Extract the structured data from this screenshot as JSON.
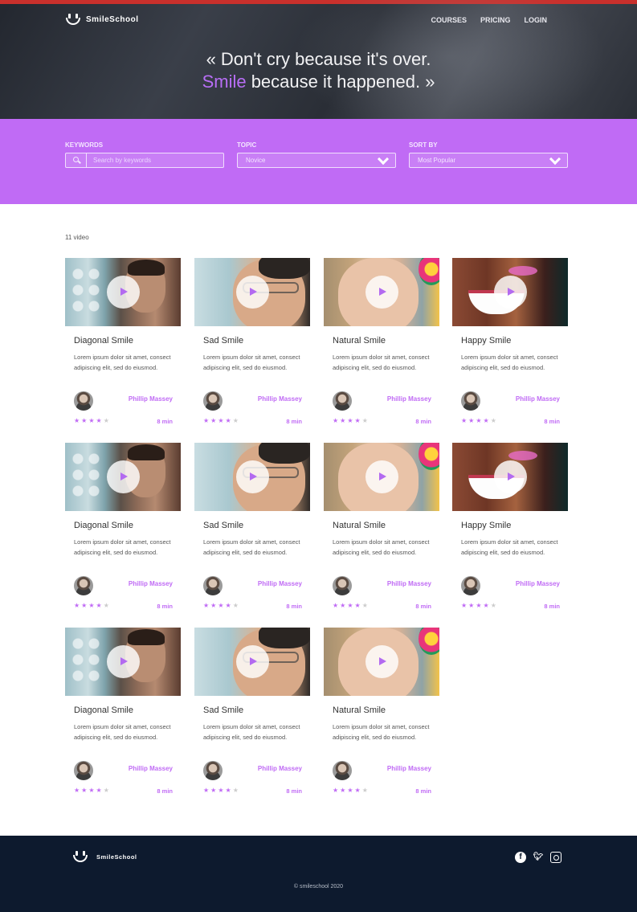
{
  "app": {
    "brand": "SmileSchool"
  },
  "nav": {
    "items": [
      "COURSES",
      "PRICING",
      "LOGIN"
    ]
  },
  "hero": {
    "quote_line1": "« Don't cry because it's over.",
    "quote_accent": "Smile",
    "quote_line2_rest": " because it happened. »"
  },
  "filters": {
    "keywords": {
      "label": "KEYWORDS",
      "placeholder": "Search by keywords"
    },
    "topic": {
      "label": "TOPIC",
      "value": "Novice"
    },
    "sort": {
      "label": "SORT BY",
      "value": "Most Popular"
    }
  },
  "results": {
    "count_label": "11 video"
  },
  "colors": {
    "accent": "#c06bf5",
    "hero_bg": "#2b2f37",
    "footer_bg": "#0d1a2e"
  },
  "cards": [
    {
      "title": "Diagonal Smile",
      "desc": "Lorem ipsum dolor sit amet, consect adipiscing elit, sed do eiusmod.",
      "author": "Phillip Massey",
      "duration": "8 min",
      "rating": 4,
      "thumb": "diagonal"
    },
    {
      "title": "Sad Smile",
      "desc": "Lorem ipsum dolor sit amet, consect adipiscing elit, sed do eiusmod.",
      "author": "Phillip Massey",
      "duration": "8 min",
      "rating": 4,
      "thumb": "sad"
    },
    {
      "title": "Natural Smile",
      "desc": "Lorem ipsum dolor sit amet, consect adipiscing elit, sed do eiusmod.",
      "author": "Phillip Massey",
      "duration": "8 min",
      "rating": 4,
      "thumb": "natural"
    },
    {
      "title": "Happy Smile",
      "desc": "Lorem ipsum dolor sit amet, consect adipiscing elit, sed do eiusmod.",
      "author": "Phillip Massey",
      "duration": "8 min",
      "rating": 4,
      "thumb": "happy"
    },
    {
      "title": "Diagonal Smile",
      "desc": "Lorem ipsum dolor sit amet, consect adipiscing elit, sed do eiusmod.",
      "author": "Phillip Massey",
      "duration": "8 min",
      "rating": 4,
      "thumb": "diagonal"
    },
    {
      "title": "Sad Smile",
      "desc": "Lorem ipsum dolor sit amet, consect adipiscing elit, sed do eiusmod.",
      "author": "Phillip Massey",
      "duration": "8 min",
      "rating": 4,
      "thumb": "sad"
    },
    {
      "title": "Natural Smile",
      "desc": "Lorem ipsum dolor sit amet, consect adipiscing elit, sed do eiusmod.",
      "author": "Phillip Massey",
      "duration": "8 min",
      "rating": 4,
      "thumb": "natural"
    },
    {
      "title": "Happy Smile",
      "desc": "Lorem ipsum dolor sit amet, consect adipiscing elit, sed do eiusmod.",
      "author": "Phillip Massey",
      "duration": "8 min",
      "rating": 4,
      "thumb": "happy"
    },
    {
      "title": "Diagonal Smile",
      "desc": "Lorem ipsum dolor sit amet, consect adipiscing elit, sed do eiusmod.",
      "author": "Phillip Massey",
      "duration": "8 min",
      "rating": 4,
      "thumb": "diagonal"
    },
    {
      "title": "Sad Smile",
      "desc": "Lorem ipsum dolor sit amet, consect adipiscing elit, sed do eiusmod.",
      "author": "Phillip Massey",
      "duration": "8 min",
      "rating": 4,
      "thumb": "sad"
    },
    {
      "title": "Natural Smile",
      "desc": "Lorem ipsum dolor sit amet, consect adipiscing elit, sed do eiusmod.",
      "author": "Phillip Massey",
      "duration": "8 min",
      "rating": 4,
      "thumb": "natural"
    }
  ],
  "footer": {
    "brand": "SmileSchool",
    "socials": [
      "facebook-icon",
      "twitter-icon",
      "instagram-icon"
    ],
    "copyright": "© smileschool 2020"
  }
}
